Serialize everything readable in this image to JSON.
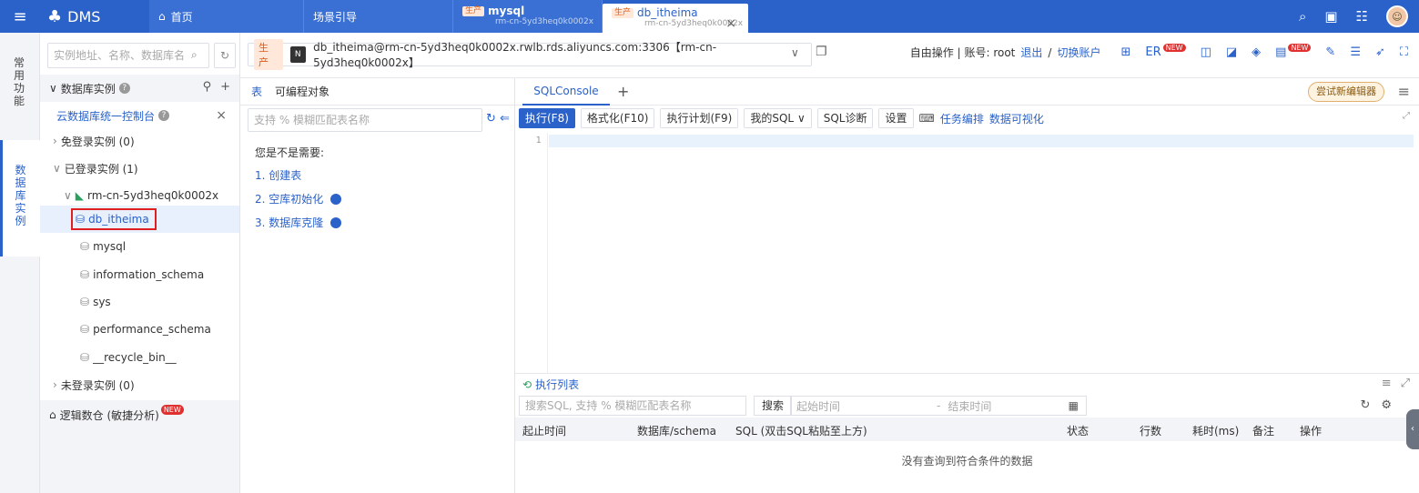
{
  "topbar": {
    "brand": "DMS",
    "home_tab": "首页",
    "scene_tab": "场景引导",
    "tabs": [
      {
        "env": "生产",
        "name": "mysql",
        "instance": "rm-cn-5yd3heq0k0002x"
      },
      {
        "env": "生产",
        "name": "db_itheima",
        "instance": "rm-cn-5yd3heq0k0002x"
      }
    ]
  },
  "rail": {
    "common": "常用功能",
    "db_instance": "数据库实例"
  },
  "tree": {
    "search_placeholder": "实例地址、名称、数据库名",
    "header": "数据库实例",
    "console_link": "云数据库统一控制台",
    "free_login": "免登录实例 (0)",
    "logged_in": "已登录实例 (1)",
    "instance": "rm-cn-5yd3heq0k0002x",
    "databases": [
      "db_itheima",
      "mysql",
      "information_schema",
      "sys",
      "performance_schema",
      "__recycle_bin__"
    ],
    "not_logged": "未登录实例 (0)",
    "logic": "逻辑数仓 (敏捷分析)",
    "new_badge": "NEW"
  },
  "conn": {
    "env": "生产",
    "db_icon": "N",
    "connection": "db_itheima@rm-cn-5yd3heq0k0002x.rwlb.rds.aliyuncs.com:3306【rm-cn-5yd3heq0k0002x】",
    "mode": "自由操作 | 账号: root",
    "logout": "退出",
    "slash": "/",
    "switch": "切换账户",
    "er": "ER"
  },
  "objects": {
    "tab_table": "表",
    "tab_program": "可编程对象",
    "search_placeholder": "支持 % 模糊匹配表名称",
    "note": "您是不是需要:",
    "items": [
      "1. 创建表",
      "2. 空库初始化",
      "3. 数据库克隆"
    ]
  },
  "sql": {
    "tab": "SQLConsole",
    "try_new": "尝试新编辑器",
    "toolbar": [
      "执行(F8)",
      "格式化(F10)",
      "执行计划(F9)",
      "我的SQL",
      "SQL诊断",
      "设置"
    ],
    "task": "任务编排",
    "visual": "数据可视化",
    "line_no": "1"
  },
  "exec": {
    "title": "执行列表",
    "search_placeholder": "搜索SQL, 支持 % 模糊匹配表名称",
    "search_btn": "搜索",
    "start": "起始时间",
    "dash": "-",
    "end": "结束时间",
    "columns": [
      "起止时间",
      "数据库/schema",
      "SQL (双击SQL粘贴至上方)",
      "状态",
      "行数",
      "耗时(ms)",
      "备注",
      "操作"
    ],
    "empty": "没有查询到符合条件的数据"
  }
}
